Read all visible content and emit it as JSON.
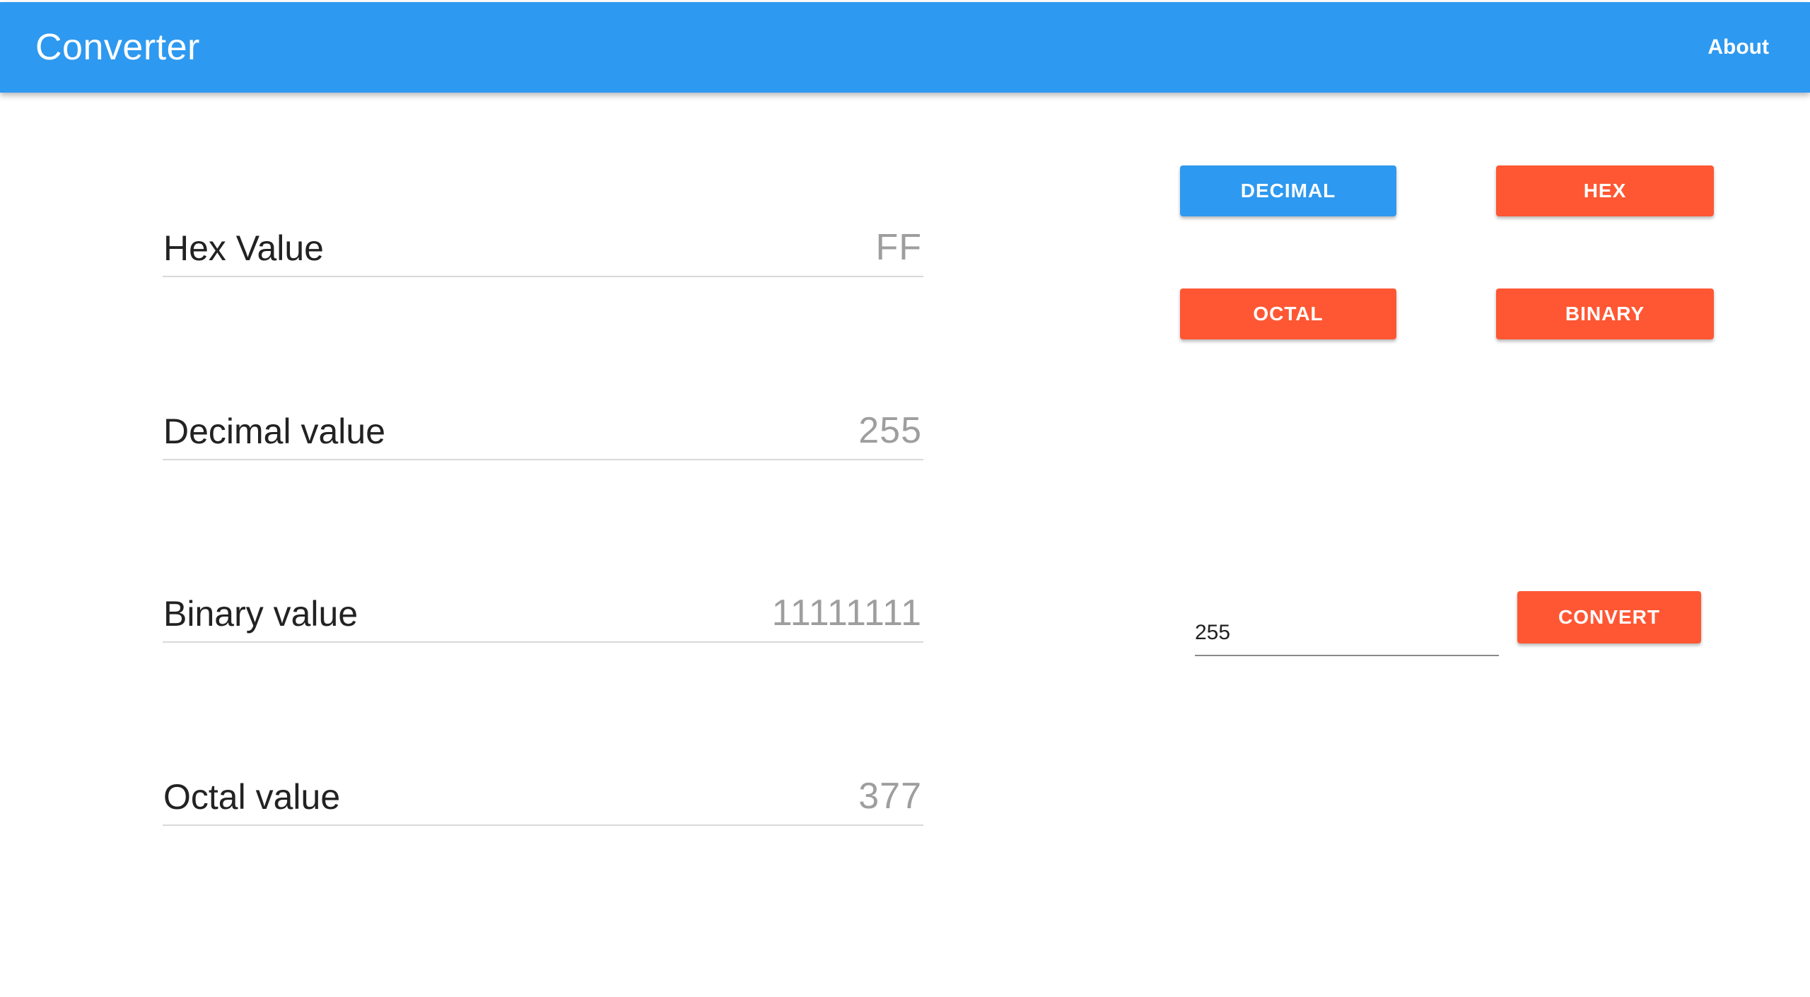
{
  "appbar": {
    "title": "Converter",
    "about_label": "About",
    "color": "#2e99f0"
  },
  "fields": {
    "hex": {
      "label": "Hex Value",
      "value": "FF"
    },
    "decimal": {
      "label": "Decimal value",
      "value": "255"
    },
    "binary": {
      "label": "Binary value",
      "value": "11111111"
    },
    "octal": {
      "label": "Octal value",
      "value": "377"
    }
  },
  "mode_buttons": {
    "decimal": "DECIMAL",
    "hex": "HEX",
    "octal": "OCTAL",
    "binary": "BINARY",
    "selected": "decimal"
  },
  "input": {
    "value": "255"
  },
  "convert_label": "CONVERT",
  "colors": {
    "selected_button": "#2e99f0",
    "unselected_button": "#ff5733"
  }
}
